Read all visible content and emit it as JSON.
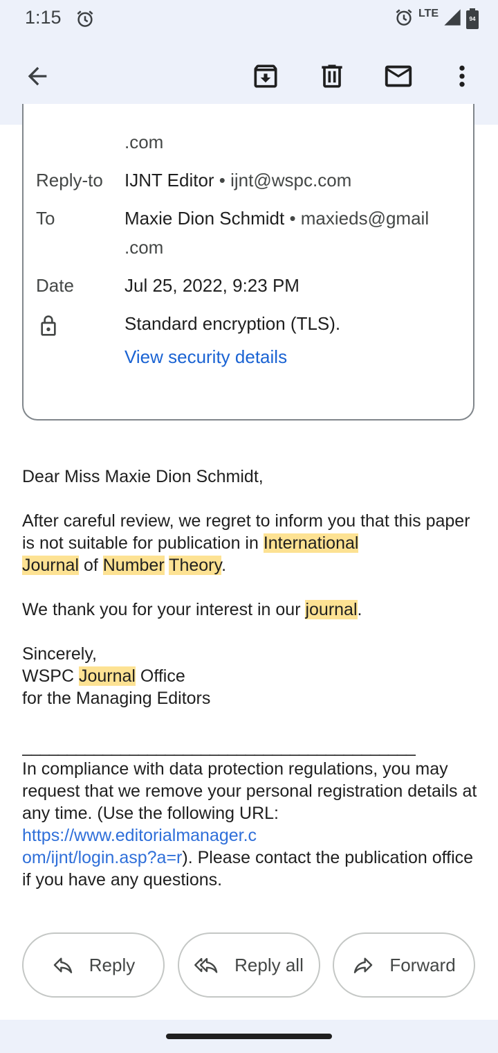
{
  "status_bar": {
    "time": "1:15",
    "network": "LTE",
    "battery_level": "94",
    "icons": [
      "alarm-icon",
      "alarm-icon",
      "signal-icon",
      "battery-icon"
    ]
  },
  "app_bar": {
    "icons": [
      "back-arrow-icon",
      "archive-icon",
      "delete-icon",
      "mark-unread-icon",
      "more-vert-icon"
    ]
  },
  "header": {
    "from_fragment": ".com",
    "reply_to": {
      "label": "Reply-to",
      "name": "IJNT Editor",
      "email": "• ijnt@wspc.com"
    },
    "to": {
      "label": "To",
      "name": "Maxie Dion Schmidt",
      "email": "• maxieds@gmail",
      "email_cont": ".com"
    },
    "date": {
      "label": "Date",
      "value": "Jul 25, 2022, 9:23 PM"
    },
    "security": {
      "text": "Standard encryption (TLS).",
      "link": "View security details"
    }
  },
  "body": {
    "greeting": "Dear Miss Maxie Dion Schmidt,",
    "p1_a": "After careful review, we regret to inform you that this paper is not suitable for publication in ",
    "p1_h1": "International",
    "p1_h2": "Journal",
    "p1_of": " of ",
    "p1_h3": "Number",
    "p1_h4": "Theory",
    "p1_end": ".",
    "p2_a": "We thank you for your interest in our ",
    "p2_h": "journal",
    "p2_end": ".",
    "sign1": "Sincerely,",
    "sign2_a": "WSPC ",
    "sign2_h": "Journal",
    "sign2_b": " Office",
    "sign3": "for the Managing Editors",
    "rule": "____________________________________________",
    "footer_a": "In compliance with data protection regulations, you may request that we remove your personal registration details at any time.  (Use the following URL: ",
    "footer_link": "https://www.editorialmanager.com/ijnt/login.asp?a=r",
    "footer_link_1": "https://www.editorialmanager.c",
    "footer_link_2": "om/ijnt/login.asp?a=r",
    "footer_b": "). Please contact the publication office if you have any questions."
  },
  "actions": {
    "reply": "Reply",
    "reply_all": "Reply all",
    "forward": "Forward"
  },
  "colors": {
    "highlight": "#fde293",
    "link": "#1a63d3",
    "app_bar_bg": "#edf1fa"
  }
}
